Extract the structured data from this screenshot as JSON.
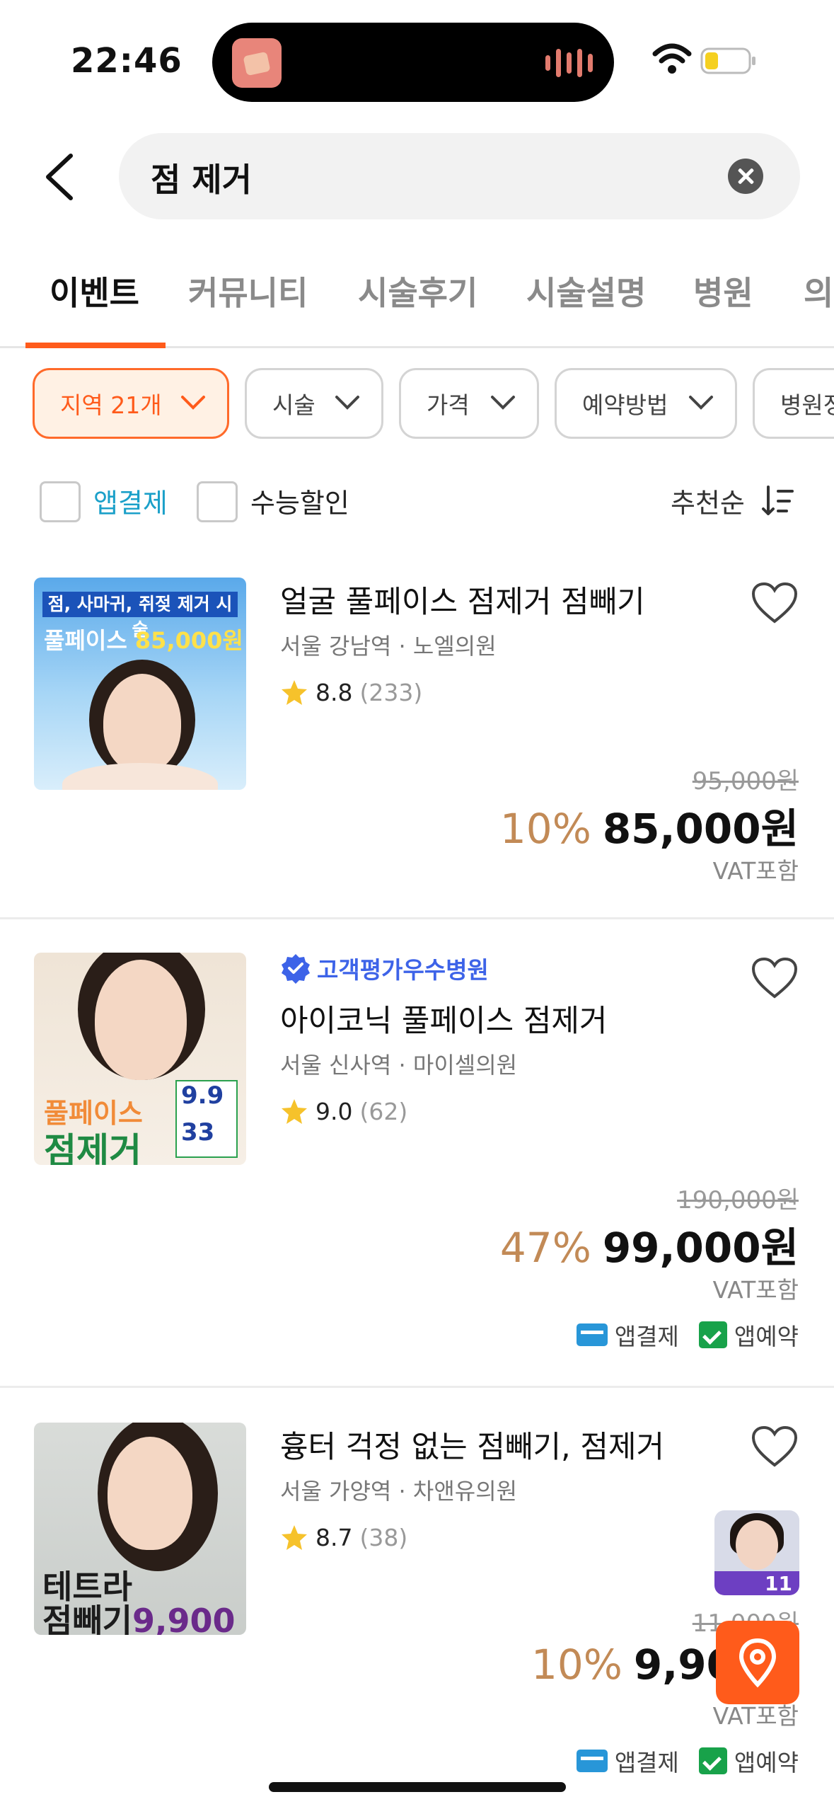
{
  "status_bar": {
    "time": "22:46"
  },
  "search": {
    "query": "점 제거"
  },
  "tabs": [
    {
      "label": "이벤트",
      "active": true
    },
    {
      "label": "커뮤니티"
    },
    {
      "label": "시술후기"
    },
    {
      "label": "시술설명"
    },
    {
      "label": "병원"
    },
    {
      "label": "의"
    }
  ],
  "filters": {
    "region": "지역 21개",
    "treatment": "시술",
    "price": "가격",
    "booking": "예약방법",
    "hospital": "병원정"
  },
  "options": {
    "app_pay": "앱결제",
    "csat_discount": "수능할인",
    "sort": "추천순"
  },
  "products": [
    {
      "title": "얼굴 풀페이스 점제거 점빼기",
      "location": "서울 강남역 · 노엘의원",
      "rating": "8.8",
      "review_count": "(233)",
      "original_price": "95,000원",
      "discount": "10%",
      "price": "85,000원",
      "vat": "VAT포함",
      "thumb_banner": "점, 사마귀, 쥐젖 제거 시술",
      "thumb_price_prefix": "풀페이스",
      "thumb_price": "85,000원"
    },
    {
      "badge": "고객평가우수병원",
      "title": "아이코닉 풀페이스 점제거",
      "location": "서울 신사역 · 마이셀의원",
      "rating": "9.0",
      "review_count": "(62)",
      "original_price": "190,000원",
      "discount": "47%",
      "price": "99,000원",
      "vat": "VAT포함",
      "tag_pay": "앱결제",
      "tag_booking": "앱예약",
      "thumb_line1": "풀페이스",
      "thumb_line2": "점제거",
      "thumb_num1": "9.9",
      "thumb_num2": "33"
    },
    {
      "title": "흉터 걱정 없는 점빼기, 점제거",
      "location": "서울 가양역 · 차앤유의원",
      "rating": "8.7",
      "review_count": "(38)",
      "original_price": "11,000원",
      "discount": "10%",
      "price": "9,90",
      "vat": "VAT포함",
      "tag_pay": "앱결제",
      "tag_booking": "앱예약",
      "thumb_line1": "테트라",
      "thumb_line2": "점빼기",
      "thumb_price": "9,900",
      "mini_ad_number": "11"
    }
  ],
  "colors": {
    "accent": "#ff5b1b",
    "discount": "#c28a56",
    "verified": "#3d63e8"
  }
}
